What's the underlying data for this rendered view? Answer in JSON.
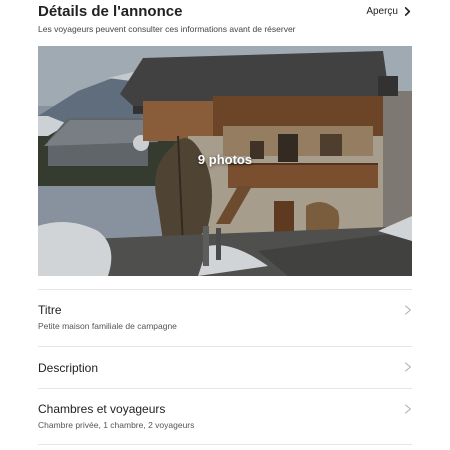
{
  "header": {
    "title": "Détails de l'annonce",
    "preview_label": "Aperçu",
    "subtitle": "Les voyageurs peuvent consulter ces informations avant de réserver"
  },
  "photo": {
    "count_label": "9 photos"
  },
  "sections": {
    "title": {
      "label": "Titre",
      "value": "Petite maison familiale de campagne"
    },
    "description": {
      "label": "Description"
    },
    "rooms": {
      "label": "Chambres et voyageurs",
      "value": "Chambre privée, 1 chambre, 2 voyageurs"
    }
  },
  "icons": {
    "preview": "chevron-right-icon",
    "row": "chevron-right-icon"
  },
  "colors": {
    "text": "#222222",
    "muted": "#555555",
    "divider": "#e6e6e6",
    "chevron": "#b0b0b0"
  }
}
